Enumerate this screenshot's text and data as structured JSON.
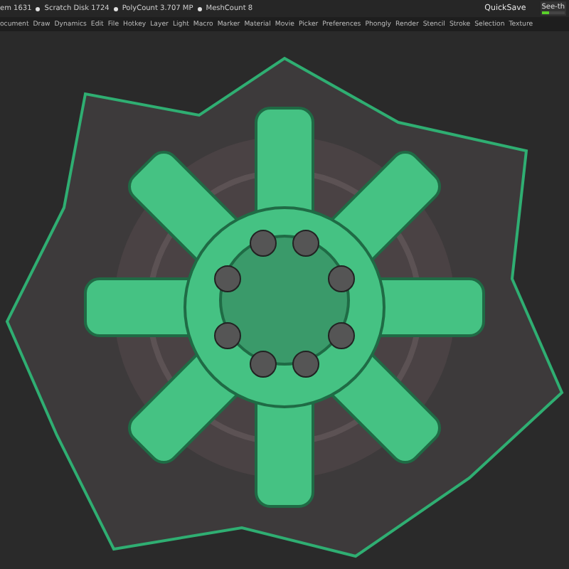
{
  "info_bar": {
    "items": [
      "em 1631",
      "Scratch Disk 1724",
      "PolyCount 3.707 MP",
      "MeshCount 8"
    ]
  },
  "menu": [
    "ocument",
    "Draw",
    "Dynamics",
    "Edit",
    "File",
    "Hotkey",
    "Layer",
    "Light",
    "Macro",
    "Marker",
    "Material",
    "Movie",
    "Picker",
    "Preferences",
    "Phongly",
    "Render",
    "Stencil",
    "Stroke",
    "Selection",
    "Texture"
  ],
  "quicksave": {
    "label": "QuickSave"
  },
  "see_through": {
    "label": "See-th",
    "level": 0.35
  }
}
